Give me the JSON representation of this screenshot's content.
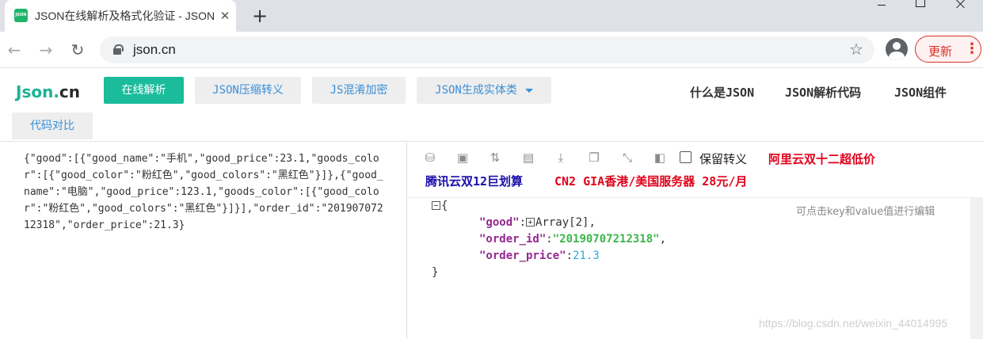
{
  "browser": {
    "tab_title": "JSON在线解析及格式化验证 - JSON.cn",
    "favicon_text": "JSON",
    "tab_close": "✕",
    "new_tab": "+",
    "url": "json.cn",
    "update_label": "更新",
    "menu_dots": "⋮",
    "back_icon": "←",
    "forward_icon": "→",
    "reload_icon": "↻",
    "star_icon": "☆"
  },
  "site": {
    "logo_part1": "Json.",
    "logo_part2": "cn",
    "nav": {
      "parse": "在线解析",
      "compress": "JSON压缩转义",
      "obfuscate": "JS混淆加密",
      "entity": "JSON生成实体类",
      "diff": "代码对比"
    },
    "links": {
      "what": "什么是JSON",
      "code": "JSON解析代码",
      "component": "JSON组件"
    }
  },
  "editor": {
    "input": "{\"good\":[{\"good_name\":\"手机\",\"good_price\":23.1,\"goods_color\":[{\"good_color\":\"粉红色\",\"good_colors\":\"黑红色\"}]},{\"good_name\":\"电脑\",\"good_price\":123.1,\"goods_color\":[{\"good_color\":\"粉红色\",\"good_colors\":\"黑红色\"}]}],\"order_id\":\"20190707212318\",\"order_price\":21.3}"
  },
  "result": {
    "keep_escape": "保留转义",
    "ad_aliyun": "阿里云双十二超低价",
    "ad_tencent": "腾讯云双12巨划算",
    "ad_cn2": "CN2 GIA香港/美国服务器 28元/月",
    "hint": "可点击key和value值进行编辑",
    "tree": {
      "open": "{",
      "close": "}",
      "good_key": "\"good\"",
      "good_value": "Array[2]",
      "order_id_key": "\"order_id\"",
      "order_id_value": "\"20190707212318\"",
      "order_price_key": "\"order_price\"",
      "order_price_value": "21.3",
      "colon": ":",
      "comma": ","
    }
  },
  "watermark": "https://blog.csdn.net/weixin_44014995"
}
